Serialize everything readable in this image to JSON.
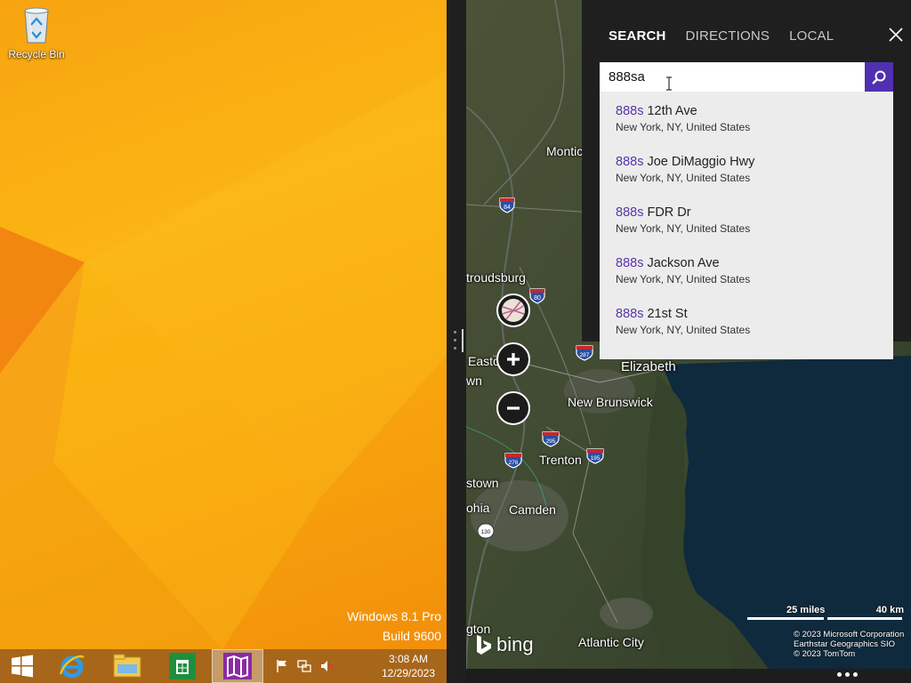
{
  "desktop": {
    "recycle_bin_label": "Recycle Bin",
    "watermark_line1": "Windows 8.1 Pro",
    "watermark_line2": "Build 9600"
  },
  "taskbar": {
    "apps": [
      "start-icon",
      "internet-explorer-icon",
      "file-explorer-icon",
      "store-icon",
      "maps-icon"
    ],
    "tray_icons": [
      "flag-icon",
      "network-icon",
      "volume-muted-icon"
    ],
    "time": "3:08 AM",
    "date": "12/29/2023",
    "accent": "#a8661a"
  },
  "search_panel": {
    "tabs": [
      "SEARCH",
      "DIRECTIONS",
      "LOCAL"
    ],
    "active_tab": "SEARCH",
    "query": "888sa",
    "button_color": "#5030b0",
    "suggestions": [
      {
        "match": "888s",
        "rest": " 12th Ave",
        "subtitle": "New York, NY, United States"
      },
      {
        "match": "888s",
        "rest": " Joe DiMaggio Hwy",
        "subtitle": "New York, NY, United States"
      },
      {
        "match": "888s",
        "rest": " FDR Dr",
        "subtitle": "New York, NY, United States"
      },
      {
        "match": "888s",
        "rest": " Jackson Ave",
        "subtitle": "New York, NY, United States"
      },
      {
        "match": "888s",
        "rest": " 21st St",
        "subtitle": "New York, NY, United States"
      }
    ]
  },
  "map": {
    "places": [
      "Montic",
      "troudsburg",
      "Easto",
      "wn",
      "Elizabeth",
      "New Brunswick",
      "Trenton",
      "stown",
      "ohia",
      "Camden",
      "gton",
      "Atlantic City"
    ],
    "shields": [
      "84",
      "80",
      "287",
      "295",
      "195",
      "276",
      "130"
    ],
    "scale_miles": "25 miles",
    "scale_km": "40 km",
    "copyright": [
      "© 2023 Microsoft Corporation",
      "Earthstar Geographics  SIO",
      "© 2023 TomTom"
    ],
    "brand": "bing"
  }
}
